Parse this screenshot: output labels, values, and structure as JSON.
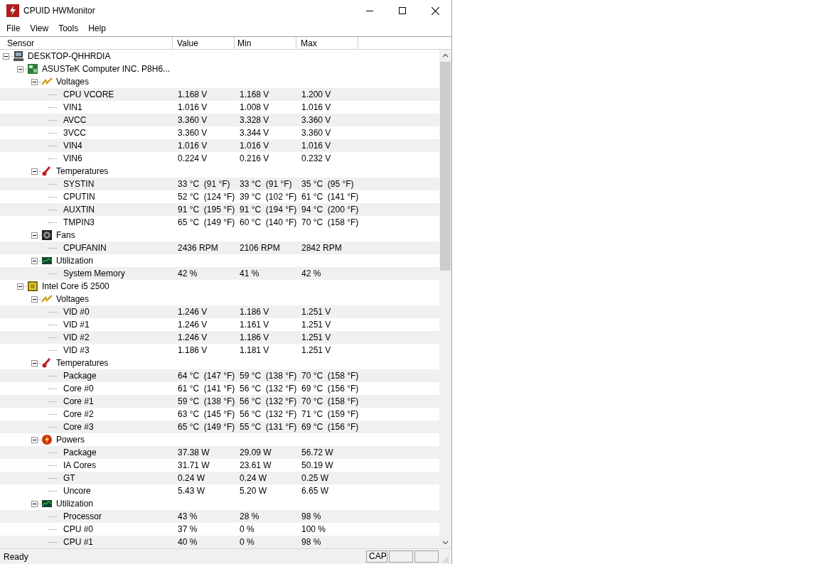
{
  "window": {
    "title": "CPUID HWMonitor"
  },
  "menu": [
    "File",
    "View",
    "Tools",
    "Help"
  ],
  "columns": [
    "Sensor",
    "Value",
    "Min",
    "Max"
  ],
  "tree": [
    {
      "kind": "computer",
      "label": "DESKTOP-QHHRDIA",
      "expanded": true,
      "children": [
        {
          "kind": "board",
          "label": "ASUSTeK Computer INC. P8H6...",
          "expanded": true,
          "children": [
            {
              "kind": "voltages",
              "label": "Voltages",
              "expanded": true,
              "sensors": [
                {
                  "name": "CPU VCORE",
                  "value": "1.168 V",
                  "min": "1.168 V",
                  "max": "1.200 V"
                },
                {
                  "name": "VIN1",
                  "value": "1.016 V",
                  "min": "1.008 V",
                  "max": "1.016 V"
                },
                {
                  "name": "AVCC",
                  "value": "3.360 V",
                  "min": "3.328 V",
                  "max": "3.360 V"
                },
                {
                  "name": "3VCC",
                  "value": "3.360 V",
                  "min": "3.344 V",
                  "max": "3.360 V"
                },
                {
                  "name": "VIN4",
                  "value": "1.016 V",
                  "min": "1.016 V",
                  "max": "1.016 V"
                },
                {
                  "name": "VIN6",
                  "value": "0.224 V",
                  "min": "0.216 V",
                  "max": "0.232 V"
                }
              ]
            },
            {
              "kind": "temperatures",
              "label": "Temperatures",
              "expanded": true,
              "sensors": [
                {
                  "name": "SYSTIN",
                  "value": "33 °C  (91 °F)",
                  "min": "33 °C  (91 °F)",
                  "max": "35 °C  (95 °F)"
                },
                {
                  "name": "CPUTIN",
                  "value": "52 °C  (124 °F)",
                  "min": "39 °C  (102 °F)",
                  "max": "61 °C  (141 °F)"
                },
                {
                  "name": "AUXTIN",
                  "value": "91 °C  (195 °F)",
                  "min": "91 °C  (194 °F)",
                  "max": "94 °C  (200 °F)"
                },
                {
                  "name": "TMPIN3",
                  "value": "65 °C  (149 °F)",
                  "min": "60 °C  (140 °F)",
                  "max": "70 °C  (158 °F)"
                }
              ]
            },
            {
              "kind": "fans",
              "label": "Fans",
              "expanded": true,
              "sensors": [
                {
                  "name": "CPUFANIN",
                  "value": "2436 RPM",
                  "min": "2106 RPM",
                  "max": "2842 RPM"
                }
              ]
            },
            {
              "kind": "utilization",
              "label": "Utilization",
              "expanded": true,
              "sensors": [
                {
                  "name": "System Memory",
                  "value": "42 %",
                  "min": "41 %",
                  "max": "42 %"
                }
              ]
            }
          ]
        },
        {
          "kind": "cpu",
          "label": "Intel Core i5 2500",
          "expanded": true,
          "children": [
            {
              "kind": "voltages",
              "label": "Voltages",
              "expanded": true,
              "sensors": [
                {
                  "name": "VID #0",
                  "value": "1.246 V",
                  "min": "1.186 V",
                  "max": "1.251 V"
                },
                {
                  "name": "VID #1",
                  "value": "1.246 V",
                  "min": "1.161 V",
                  "max": "1.251 V"
                },
                {
                  "name": "VID #2",
                  "value": "1.246 V",
                  "min": "1.186 V",
                  "max": "1.251 V"
                },
                {
                  "name": "VID #3",
                  "value": "1.186 V",
                  "min": "1.181 V",
                  "max": "1.251 V"
                }
              ]
            },
            {
              "kind": "temperatures",
              "label": "Temperatures",
              "expanded": true,
              "sensors": [
                {
                  "name": "Package",
                  "value": "64 °C  (147 °F)",
                  "min": "59 °C  (138 °F)",
                  "max": "70 °C  (158 °F)"
                },
                {
                  "name": "Core #0",
                  "value": "61 °C  (141 °F)",
                  "min": "56 °C  (132 °F)",
                  "max": "69 °C  (156 °F)"
                },
                {
                  "name": "Core #1",
                  "value": "59 °C  (138 °F)",
                  "min": "56 °C  (132 °F)",
                  "max": "70 °C  (158 °F)"
                },
                {
                  "name": "Core #2",
                  "value": "63 °C  (145 °F)",
                  "min": "56 °C  (132 °F)",
                  "max": "71 °C  (159 °F)"
                },
                {
                  "name": "Core #3",
                  "value": "65 °C  (149 °F)",
                  "min": "55 °C  (131 °F)",
                  "max": "69 °C  (156 °F)"
                }
              ]
            },
            {
              "kind": "powers",
              "label": "Powers",
              "expanded": true,
              "sensors": [
                {
                  "name": "Package",
                  "value": "37.38 W",
                  "min": "29.09 W",
                  "max": "56.72 W"
                },
                {
                  "name": "IA Cores",
                  "value": "31.71 W",
                  "min": "23.61 W",
                  "max": "50.19 W"
                },
                {
                  "name": "GT",
                  "value": "0.24 W",
                  "min": "0.24 W",
                  "max": "0.25 W"
                },
                {
                  "name": "Uncore",
                  "value": "5.43 W",
                  "min": "5.20 W",
                  "max": "6.65 W"
                }
              ]
            },
            {
              "kind": "utilization",
              "label": "Utilization",
              "expanded": true,
              "sensors": [
                {
                  "name": "Processor",
                  "value": "43 %",
                  "min": "28 %",
                  "max": "98 %"
                },
                {
                  "name": "CPU #0",
                  "value": "37 %",
                  "min": "0 %",
                  "max": "100 %"
                },
                {
                  "name": "CPU #1",
                  "value": "40 %",
                  "min": "0 %",
                  "max": "98 %"
                }
              ]
            }
          ]
        }
      ]
    }
  ],
  "status_bar": {
    "text": "Ready",
    "indicators": [
      "CAP"
    ]
  }
}
